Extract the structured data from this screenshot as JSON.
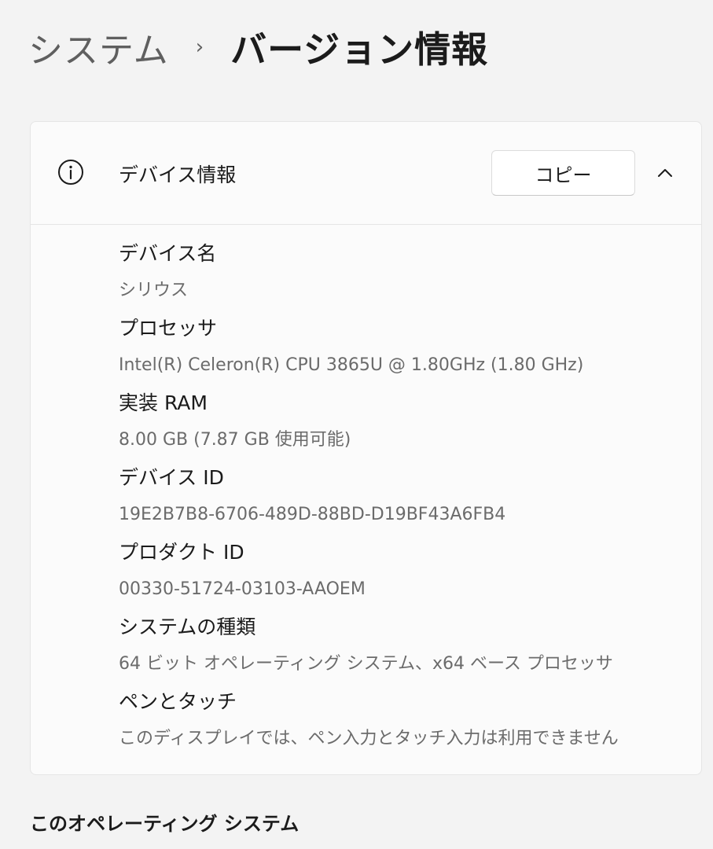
{
  "breadcrumb": {
    "parent": "システム",
    "separator": "›",
    "current": "バージョン情報"
  },
  "device_info": {
    "header_title": "デバイス情報",
    "copy_label": "コピー",
    "icons": {
      "info": "info-circle-icon",
      "collapse": "chevron-up-icon"
    },
    "properties": [
      {
        "label": "デバイス名",
        "value": "シリウス"
      },
      {
        "label": "プロセッサ",
        "value": "Intel(R) Celeron(R) CPU 3865U @ 1.80GHz (1.80 GHz)"
      },
      {
        "label": "実装 RAM",
        "value": "8.00 GB (7.87 GB 使用可能)"
      },
      {
        "label": "デバイス ID",
        "value": "19E2B7B8-6706-489D-88BD-D19BF43A6FB4"
      },
      {
        "label": "プロダクト ID",
        "value": "00330-51724-03103-AAOEM"
      },
      {
        "label": "システムの種類",
        "value": "64 ビット オペレーティング システム、x64 ベース プロセッサ"
      },
      {
        "label": "ペンとタッチ",
        "value": "このディスプレイでは、ペン入力とタッチ入力は利用できません"
      }
    ]
  },
  "os_section": {
    "title": "このオペレーティング システム"
  },
  "colors": {
    "background": "#f3f3f3",
    "card": "#fbfbfb",
    "text_primary": "#1b1b1b",
    "text_secondary": "#6b6b6b"
  }
}
